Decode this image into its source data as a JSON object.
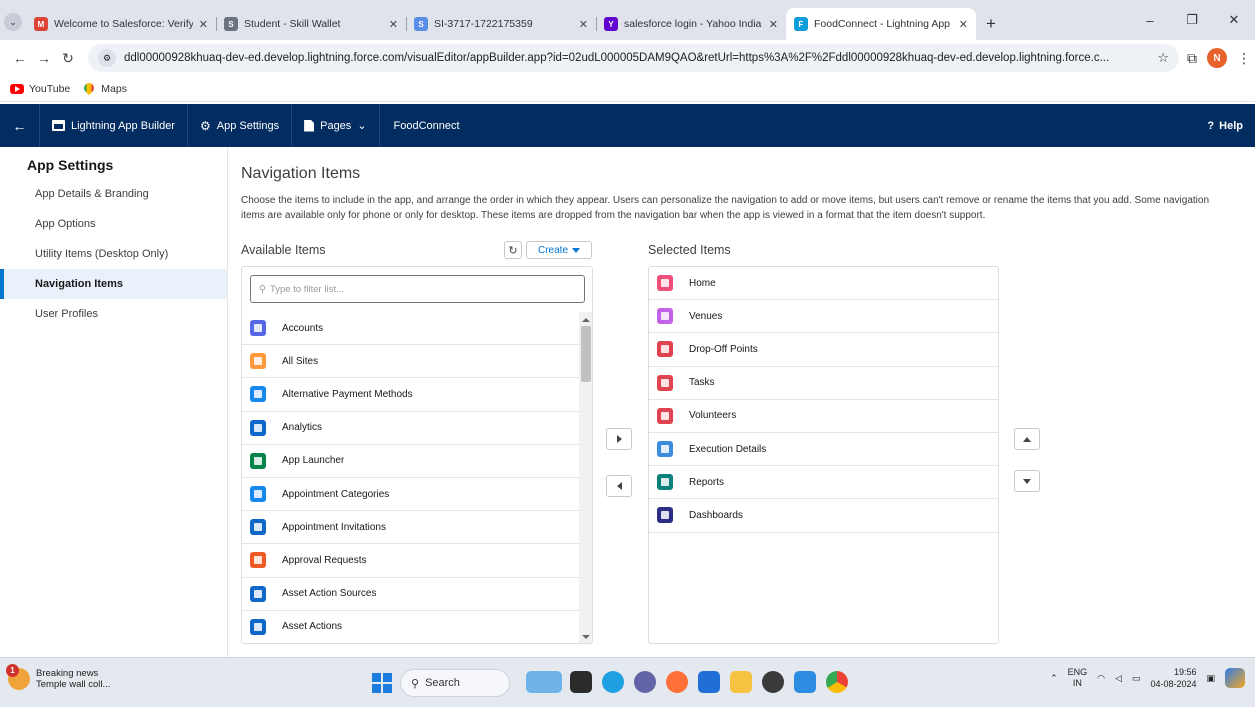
{
  "browser": {
    "tabs": [
      {
        "label": "Welcome to Salesforce: Verify y",
        "icon_color": "#db4437",
        "glyph": "M"
      },
      {
        "label": "Student - Skill Wallet",
        "icon_color": "#6b7280",
        "glyph": "S"
      },
      {
        "label": "SI-3717-1722175359",
        "icon_color": "#5b8ee6",
        "glyph": "S"
      },
      {
        "label": "salesforce login - Yahoo India S",
        "icon_color": "#6001d2",
        "glyph": "Y"
      },
      {
        "label": "FoodConnect - Lightning App B",
        "icon_color": "#0d9dda",
        "glyph": "F"
      }
    ],
    "url": "ddl00000928khuaq-dev-ed.develop.lightning.force.com/visualEditor/appBuilder.app?id=02udL000005DAM9QAO&retUrl=https%3A%2F%2Fddl00000928khuaq-dev-ed.develop.lightning.force.c...",
    "profile_initial": "N",
    "bookmarks": [
      {
        "label": "YouTube",
        "icon": "youtube-icon"
      },
      {
        "label": "Maps",
        "icon": "maps-icon"
      }
    ]
  },
  "sfheader": {
    "back": "←",
    "builder": "Lightning App Builder",
    "settings": "App Settings",
    "pages": "Pages",
    "app_name": "FoodConnect",
    "help": "Help"
  },
  "sidebar": {
    "title": "App Settings",
    "items": [
      {
        "label": "App Details & Branding",
        "active": false
      },
      {
        "label": "App Options",
        "active": false
      },
      {
        "label": "Utility Items (Desktop Only)",
        "active": false
      },
      {
        "label": "Navigation Items",
        "active": true
      },
      {
        "label": "User Profiles",
        "active": false
      }
    ]
  },
  "main": {
    "title": "Navigation Items",
    "description": "Choose the items to include in the app, and arrange the order in which they appear. Users can personalize the navigation to add or move items, but users can't remove or rename the items that you add. Some navigation items are available only for phone or only for desktop. These items are dropped from the navigation bar when the app is viewed in a format that the item doesn't support.",
    "available_title": "Available Items",
    "create_label": "Create",
    "filter_placeholder": "Type to filter list...",
    "available": [
      {
        "label": "Accounts",
        "color": "#5867e8"
      },
      {
        "label": "All Sites",
        "color": "#ff9a3c"
      },
      {
        "label": "Alternative Payment Methods",
        "color": "#1589ee"
      },
      {
        "label": "Analytics",
        "color": "#0f68c7"
      },
      {
        "label": "App Launcher",
        "color": "#04844b"
      },
      {
        "label": "Appointment Categories",
        "color": "#1589ee"
      },
      {
        "label": "Appointment Invitations",
        "color": "#0f68c7"
      },
      {
        "label": "Approval Requests",
        "color": "#f05a24"
      },
      {
        "label": "Asset Action Sources",
        "color": "#0f68c7"
      },
      {
        "label": "Asset Actions",
        "color": "#0f68c7"
      }
    ],
    "selected_title": "Selected Items",
    "selected": [
      {
        "label": "Home",
        "color": "#ef4e79"
      },
      {
        "label": "Venues",
        "color": "#c262e6"
      },
      {
        "label": "Drop-Off Points",
        "color": "#e0434f"
      },
      {
        "label": "Tasks",
        "color": "#e0434f"
      },
      {
        "label": "Volunteers",
        "color": "#e0434f"
      },
      {
        "label": "Execution Details",
        "color": "#3c8dde"
      },
      {
        "label": "Reports",
        "color": "#0b827c"
      },
      {
        "label": "Dashboards",
        "color": "#2a2e85"
      }
    ]
  },
  "taskbar": {
    "news_title": "Breaking news",
    "news_sub": "Temple wall coll...",
    "news_badge": "1",
    "search": "Search",
    "lang_top": "ENG",
    "lang_bottom": "IN",
    "time": "19:56",
    "date": "04-08-2024"
  }
}
